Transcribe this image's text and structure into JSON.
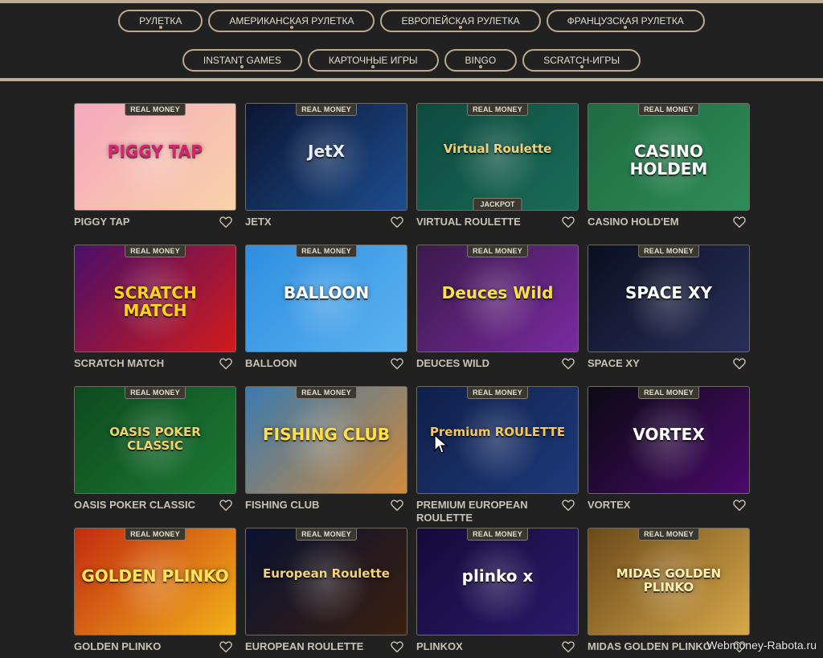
{
  "filters_row1": [
    "РУЛЕТКА",
    "АМЕРИКАНСКАЯ РУЛЕТКА",
    "ЕВРОПЕЙСКАЯ РУЛЕТКА",
    "ФРАНЦУЗСКАЯ РУЛЕТКА"
  ],
  "filters_row2": [
    "INSTANT GAMES",
    "КАРТОЧНЫЕ ИГРЫ",
    "BINGO",
    "SCRATCH-ИГРЫ"
  ],
  "badge_label": "REAL MONEY",
  "games": [
    {
      "name": "PIGGY TAP",
      "art_text": "PIGGY TAP",
      "bg": "#f6a8bf",
      "bg2": "#f8d3a8",
      "art_color": "#d9236e"
    },
    {
      "name": "JETX",
      "art_text": "JetX",
      "bg": "#0c1530",
      "bg2": "#1d4d8f",
      "art_color": "#e8f0ff"
    },
    {
      "name": "VIRTUAL ROULETTE",
      "art_text": "Virtual Roulette",
      "bg": "#0e4a3e",
      "bg2": "#1a6b57",
      "art_color": "#f0d27a",
      "extra_badge": "JACKPOT"
    },
    {
      "name": "CASINO HOLD'EM",
      "art_text": "CASINO HOLDEM",
      "bg": "#1f6b42",
      "bg2": "#2f8c57",
      "art_color": "#ffffff"
    },
    {
      "name": "SCRATCH MATCH",
      "art_text": "SCRATCH MATCH",
      "bg": "#4a0f6a",
      "bg2": "#d11b1b",
      "art_color": "#ffd21a"
    },
    {
      "name": "BALLOON",
      "art_text": "BALLOON",
      "bg": "#2f8ee0",
      "bg2": "#5cb3f0",
      "art_color": "#ffffff"
    },
    {
      "name": "DEUCES WILD",
      "art_text": "Deuces Wild",
      "bg": "#3a1a4a",
      "bg2": "#7a2aa0",
      "art_color": "#f7e04a"
    },
    {
      "name": "SPACE XY",
      "art_text": "SPACE XY",
      "bg": "#0a1020",
      "bg2": "#2a2f5a",
      "art_color": "#ffffff"
    },
    {
      "name": "OASIS POKER CLASSIC",
      "art_text": "OASIS POKER CLASSIC",
      "bg": "#0d4a1e",
      "bg2": "#1d7a35",
      "art_color": "#f2d36a"
    },
    {
      "name": "FISHING CLUB",
      "art_text": "FISHING CLUB",
      "bg": "#3a7ab0",
      "bg2": "#d08a3a",
      "art_color": "#ffe04a"
    },
    {
      "name": "PREMIUM EUROPEAN ROULETTE",
      "art_text": "Premium ROULETTE",
      "bg": "#0f1f4a",
      "bg2": "#1f3a7a",
      "art_color": "#f2c85a"
    },
    {
      "name": "VORTEX",
      "art_text": "VORTEX",
      "bg": "#0a0a12",
      "bg2": "#4a0a6a",
      "art_color": "#ffffff"
    },
    {
      "name": "GOLDEN PLINKO",
      "art_text": "GOLDEN PLINKO",
      "bg": "#c22a10",
      "bg2": "#f2b21a",
      "art_color": "#ffe35a"
    },
    {
      "name": "EUROPEAN ROULETTE",
      "art_text": "European Roulette",
      "bg": "#0a1230",
      "bg2": "#3a2010",
      "art_color": "#f2d27a"
    },
    {
      "name": "PLINKOX",
      "art_text": "plinko x",
      "bg": "#150a3a",
      "bg2": "#2a1a6a",
      "art_color": "#ffffff"
    },
    {
      "name": "MIDAS GOLDEN PLINKO",
      "art_text": "MIDAS GOLDEN PLINKO",
      "bg": "#6a4a1a",
      "bg2": "#d8a84a",
      "art_color": "#fff0b0"
    }
  ],
  "watermark": "Webmoney-Rabota.ru"
}
